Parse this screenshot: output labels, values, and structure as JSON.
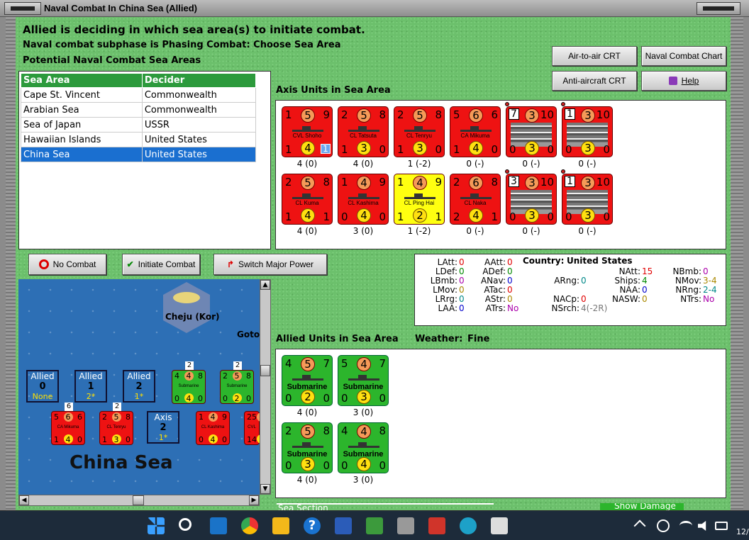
{
  "window": {
    "title": "Naval Combat In China Sea (Allied)"
  },
  "header": {
    "line1": "Allied is deciding in which sea area(s) to initiate combat.",
    "line2": "Naval combat subphase is Phasing Combat: Choose Sea Area",
    "line3": "Potential Naval Combat Sea Areas"
  },
  "buttons": {
    "air_to_air": "Air-to-air CRT",
    "naval_chart": "Naval Combat Chart",
    "anti_aircraft": "Anti-aircraft CRT",
    "help": "Help",
    "no_combat": "No Combat",
    "initiate_combat": "Initiate Combat",
    "switch_power": "Switch Major Power"
  },
  "sea_table": {
    "headers": [
      "Sea Area",
      "Decider"
    ],
    "rows": [
      [
        "Cape St. Vincent",
        "Commonwealth"
      ],
      [
        "Arabian Sea",
        "Commonwealth"
      ],
      [
        "Sea of Japan",
        "USSR"
      ],
      [
        "Hawaiian Islands",
        "United States"
      ],
      [
        "China Sea",
        "United States"
      ]
    ],
    "selected": 4
  },
  "axis": {
    "title": "Axis Units in Sea Area",
    "units": [
      {
        "tl": "1",
        "tc": "5",
        "tr": "9",
        "name": "CVL Shoho",
        "bl": "1",
        "bc": "4",
        "br": "1",
        "cap": "4 (0)",
        "color": "red",
        "extra": "1"
      },
      {
        "tl": "2",
        "tc": "5",
        "tr": "8",
        "name": "CL Tatsuta",
        "bl": "1",
        "bc": "3",
        "br": "0",
        "cap": "4 (0)",
        "color": "red"
      },
      {
        "tl": "2",
        "tc": "5",
        "tr": "8",
        "name": "CL Tenryu",
        "bl": "1",
        "bc": "3",
        "br": "0",
        "cap": "1 (-2)",
        "color": "red"
      },
      {
        "tl": "5",
        "tc": "6",
        "tr": "6",
        "name": "CA Mikuma",
        "bl": "1",
        "bc": "4",
        "br": "0",
        "cap": "0 (-)",
        "color": "red"
      },
      {
        "box": "7",
        "tc": "3",
        "tr": "10",
        "bl": "0",
        "bc": "3",
        "br": "0",
        "cap": "0 (-)",
        "color": "red",
        "carrier": true
      },
      {
        "box": "1",
        "tc": "3",
        "tr": "10",
        "bl": "0",
        "bc": "3",
        "br": "0",
        "cap": "0 (-)",
        "color": "red",
        "carrier": true
      },
      {
        "tl": "2",
        "tc": "5",
        "tr": "8",
        "name": "CL Kuma",
        "bl": "1",
        "bc": "4",
        "br": "1",
        "cap": "4 (0)",
        "color": "red"
      },
      {
        "tl": "1",
        "tc": "4",
        "tr": "9",
        "name": "CL Kashima",
        "bl": "0",
        "bc": "4",
        "br": "0",
        "cap": "3 (0)",
        "color": "red"
      },
      {
        "tl": "1",
        "tc": "4",
        "tr": "9",
        "name": "CL Ping Hai",
        "bl": "1",
        "bc": "2",
        "br": "1",
        "cap": "1 (-2)",
        "color": "yellow"
      },
      {
        "tl": "2",
        "tc": "6",
        "tr": "8",
        "name": "CL Naka",
        "bl": "2",
        "bc": "4",
        "br": "1",
        "cap": "0 (-)",
        "color": "red"
      },
      {
        "box": "3",
        "tc": "3",
        "tr": "10",
        "bl": "0",
        "bc": "3",
        "br": "0",
        "cap": "0 (-)",
        "color": "red",
        "carrier": true
      },
      {
        "box": "1",
        "tc": "3",
        "tr": "10",
        "bl": "0",
        "bc": "3",
        "br": "0",
        "cap": "0 (-)",
        "color": "red",
        "carrier": true
      }
    ]
  },
  "allied": {
    "title": "Allied Units in Sea Area",
    "weather_label": "Weather:",
    "weather": "Fine",
    "units": [
      {
        "tl": "4",
        "tc": "5",
        "tr": "7",
        "name": "Submarine",
        "bl": "0",
        "bc": "2",
        "br": "0",
        "cap": "4 (0)"
      },
      {
        "tl": "5",
        "tc": "4",
        "tr": "7",
        "name": "Submarine",
        "bl": "0",
        "bc": "3",
        "br": "0",
        "cap": "3 (0)"
      },
      {
        "tl": "2",
        "tc": "5",
        "tr": "8",
        "name": "Submarine",
        "bl": "0",
        "bc": "3",
        "br": "0",
        "cap": "4 (0)"
      },
      {
        "tl": "4",
        "tc": "4",
        "tr": "8",
        "name": "Submarine",
        "bl": "0",
        "bc": "4",
        "br": "0",
        "cap": "3 (0)"
      }
    ]
  },
  "stats": {
    "country_label": "Country:",
    "country": "United States",
    "items": [
      {
        "k": "LAtt:",
        "v": "0",
        "c": "#e00000"
      },
      {
        "k": "LDef:",
        "v": "0",
        "c": "#008800"
      },
      {
        "k": "LBmb:",
        "v": "0",
        "c": "#aa00aa"
      },
      {
        "k": "LMov:",
        "v": "0",
        "c": "#aa8800"
      },
      {
        "k": "LRrg:",
        "v": "0",
        "c": "#008888"
      },
      {
        "k": "LAA:",
        "v": "0",
        "c": "#0000cc"
      },
      {
        "k": "AAtt:",
        "v": "0",
        "c": "#e00000"
      },
      {
        "k": "ADef:",
        "v": "0",
        "c": "#008800"
      },
      {
        "k": "ANav:",
        "v": "0",
        "c": "#0000cc"
      },
      {
        "k": "ATac:",
        "v": "0",
        "c": "#e00000"
      },
      {
        "k": "AStr:",
        "v": "0",
        "c": "#aa8800"
      },
      {
        "k": "ATrs:",
        "v": "No",
        "c": "#aa00aa"
      },
      {
        "k": "ARng:",
        "v": "0",
        "c": "#008888"
      },
      {
        "k": "NACp:",
        "v": "0",
        "c": "#e00000"
      },
      {
        "k": "NSrch:",
        "v": "4(-2R)",
        "c": "#777"
      },
      {
        "k": "NAtt:",
        "v": "15",
        "c": "#e00000"
      },
      {
        "k": "Ships:",
        "v": "4",
        "c": "#008800"
      },
      {
        "k": "NAA:",
        "v": "0",
        "c": "#0000cc"
      },
      {
        "k": "NASW:",
        "v": "0",
        "c": "#aa8800"
      },
      {
        "k": "NBmb:",
        "v": "0",
        "c": "#aa00aa"
      },
      {
        "k": "NMov:",
        "v": "3-4",
        "c": "#aa8800"
      },
      {
        "k": "NRng:",
        "v": "2-4",
        "c": "#008888"
      },
      {
        "k": "NTrs:",
        "v": "No",
        "c": "#aa00aa"
      }
    ]
  },
  "map": {
    "hex_label": "Cheju (Kor)",
    "goto_label": "Goto",
    "sea_name": "China Sea",
    "boxes": [
      {
        "a": "Allied",
        "n": "0",
        "s": "None"
      },
      {
        "a": "Allied",
        "n": "1",
        "s": "2*"
      },
      {
        "a": "Allied",
        "n": "2",
        "s": "1*"
      },
      {
        "a": "Axis",
        "n": "2",
        "s": "1*"
      }
    ],
    "counters": [
      {
        "t": [
          "4",
          "4",
          "8"
        ],
        "m": "Submarine",
        "b": [
          "0",
          "4",
          "0"
        ],
        "cnt": "2",
        "color": "green"
      },
      {
        "t": [
          "2",
          "5",
          "8"
        ],
        "m": "Submarine",
        "b": [
          "0",
          "2",
          "0"
        ],
        "cnt": "2",
        "color": "green"
      },
      {
        "t": [
          "5",
          "6",
          "6"
        ],
        "m": "CA Mikuma",
        "b": [
          "1",
          "4",
          "0"
        ],
        "cnt": "6",
        "color": "red"
      },
      {
        "t": [
          "2",
          "5",
          "8"
        ],
        "m": "CL Tenryu",
        "b": [
          "1",
          "3",
          "0"
        ],
        "cnt": "2",
        "color": "red"
      },
      {
        "t": [
          "1",
          "4",
          "9"
        ],
        "m": "CL Kashima",
        "b": [
          "0",
          "4",
          "0"
        ],
        "cnt": "",
        "color": "red"
      },
      {
        "t": [
          "2",
          "5",
          ""
        ],
        "m": "CVL",
        "b": [
          "1",
          "4",
          ""
        ],
        "cnt": "",
        "color": "red"
      }
    ]
  },
  "footer": {
    "sea_section": "Sea Section",
    "show_damage": "Show Damage"
  },
  "taskbar": {
    "clock": "12/"
  }
}
